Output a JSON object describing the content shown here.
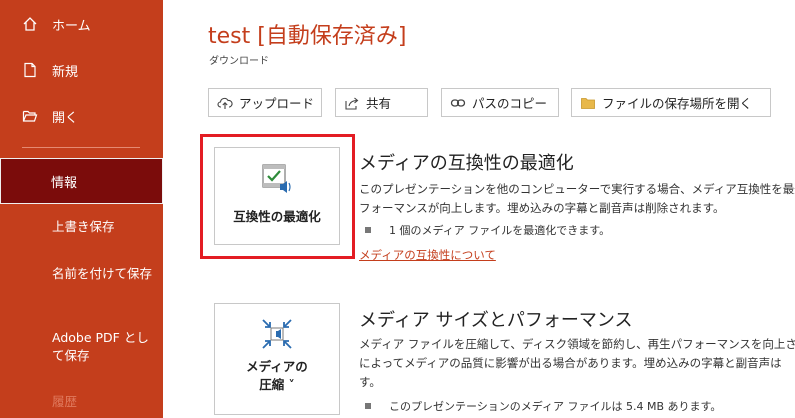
{
  "sidebar": {
    "items": [
      {
        "label": "ホーム",
        "icon": "home-icon"
      },
      {
        "label": "新規",
        "icon": "new-document-icon"
      },
      {
        "label": "開く",
        "icon": "open-folder-icon"
      }
    ],
    "selected": {
      "label": "情報"
    },
    "sub_items": [
      {
        "label": "上書き保存"
      },
      {
        "label": "名前を付けて保存"
      },
      {
        "label": "Adobe PDF として保存"
      },
      {
        "label": "履歴"
      }
    ]
  },
  "header": {
    "title": "test [自動保存済み]",
    "subtitle": "ダウンロード"
  },
  "toolbar": {
    "upload": "アップロード",
    "share": "共有",
    "copy_path": "パスのコピー",
    "open_location": "ファイルの保存場所を開く"
  },
  "optimize": {
    "button_label": "互換性の最適化",
    "heading": "メディアの互換性の最適化",
    "desc_line1": "このプレゼンテーションを他のコンピューターで実行する場合、メディア互換性を最適",
    "desc_line2": "フォーマンスが向上します。埋め込みの字幕と副音声は削除されます。",
    "bullet": "1 個のメディア ファイルを最適化できます。",
    "link": "メディアの互換性について"
  },
  "compress": {
    "button_label_line1": "メディアの",
    "button_label_line2": "圧縮 ˅",
    "heading": "メディア サイズとパフォーマンス",
    "desc_line1": "メディア ファイルを圧縮して、ディスク領域を節約し、再生パフォーマンスを向上させ",
    "desc_line2": "によってメディアの品質に影響が出る場合があります。埋め込みの字幕と副音声は",
    "desc_line3": "す。",
    "bullet": "このプレゼンテーションのメディア ファイルは 5.4 MB あります。"
  },
  "colors": {
    "sidebar": "#c43e1c",
    "selected": "#7b0c0b",
    "accent": "#c43e1c",
    "highlight": "#e31c23"
  }
}
